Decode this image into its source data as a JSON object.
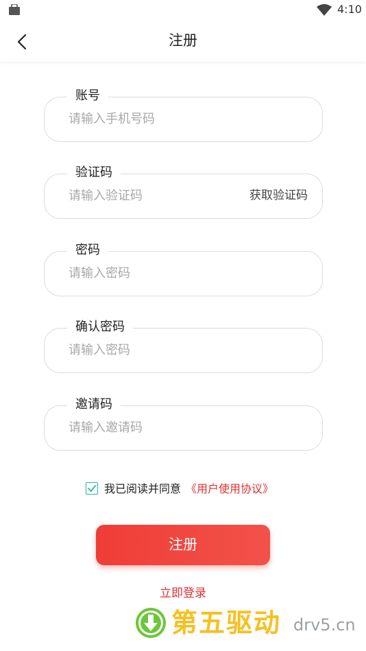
{
  "status_bar": {
    "time": "4:10",
    "icons": [
      "bag-icon",
      "wifi-icon"
    ]
  },
  "nav": {
    "title": "注册",
    "back_icon": "chevron-left-icon"
  },
  "form": {
    "account": {
      "label": "账号",
      "placeholder": "请输入手机号码"
    },
    "code": {
      "label": "验证码",
      "placeholder": "请输入验证码",
      "get_code_label": "获取验证码"
    },
    "password": {
      "label": "密码",
      "placeholder": "请输入密码"
    },
    "confirm_password": {
      "label": "确认密码",
      "placeholder": "请输入密码"
    },
    "invite": {
      "label": "邀请码",
      "placeholder": "请输入邀请码"
    }
  },
  "agreement": {
    "checked": true,
    "text": "我已阅读并同意",
    "link": "《用户使用协议》"
  },
  "register_button": "注册",
  "login_link": "立即登录",
  "watermark": {
    "text": "第五驱动",
    "url": "drv5.cn"
  },
  "colors": {
    "accent_red": "#e0302f",
    "button_red": "#ef3d36",
    "checkbox_teal": "#2bb3a0",
    "watermark_yellow": "#f5c022",
    "watermark_green": "#6cc63a"
  }
}
